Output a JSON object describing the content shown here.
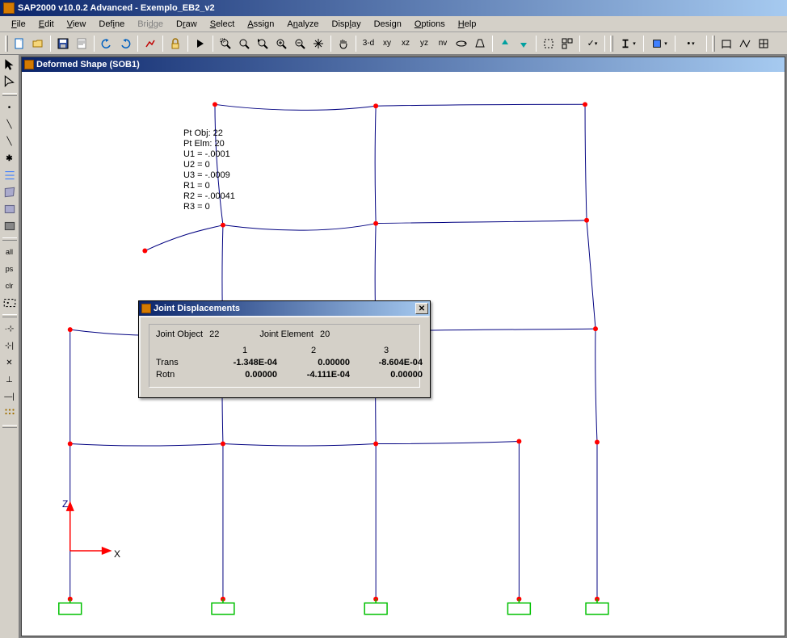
{
  "app": {
    "title": "SAP2000 v10.0.2 Advanced  -  Exemplo_EB2_v2"
  },
  "menu": {
    "file": "File",
    "edit": "Edit",
    "view": "View",
    "define": "Define",
    "bridge": "Bridge",
    "draw": "Draw",
    "select": "Select",
    "assign": "Assign",
    "analyze": "Analyze",
    "display": "Display",
    "design": "Design",
    "options": "Options",
    "help": "Help"
  },
  "toolbar": {
    "v3d": "3-d",
    "vxy": "xy",
    "vxz": "xz",
    "vyz": "yz",
    "vnv": "nv"
  },
  "sidebar": {
    "all": "all",
    "ps": "ps",
    "clr": "clr"
  },
  "inner_window": {
    "title": "Deformed Shape (SOB1)"
  },
  "annotation": {
    "l1": "Pt Obj: 22",
    "l2": "Pt Elm: 20",
    "l3": "U1 = -.0001",
    "l4": "U2 =  0",
    "l5": "U3 = -.0009",
    "l6": "R1 =  0",
    "l7": "R2 = -.00041",
    "l8": "R3 =  0"
  },
  "axes": {
    "z": "Z",
    "x": "X"
  },
  "dialog": {
    "title": "Joint Displacements",
    "joint_object_label": "Joint  Object",
    "joint_object_value": "22",
    "joint_element_label": "Joint  Element",
    "joint_element_value": "20",
    "h1": "1",
    "h2": "2",
    "h3": "3",
    "trans_label": "Trans",
    "trans_1": "-1.348E-04",
    "trans_2": "0.00000",
    "trans_3": "-8.604E-04",
    "rotn_label": "Rotn",
    "rotn_1": "0.00000",
    "rotn_2": "-4.111E-04",
    "rotn_3": "0.00000"
  }
}
